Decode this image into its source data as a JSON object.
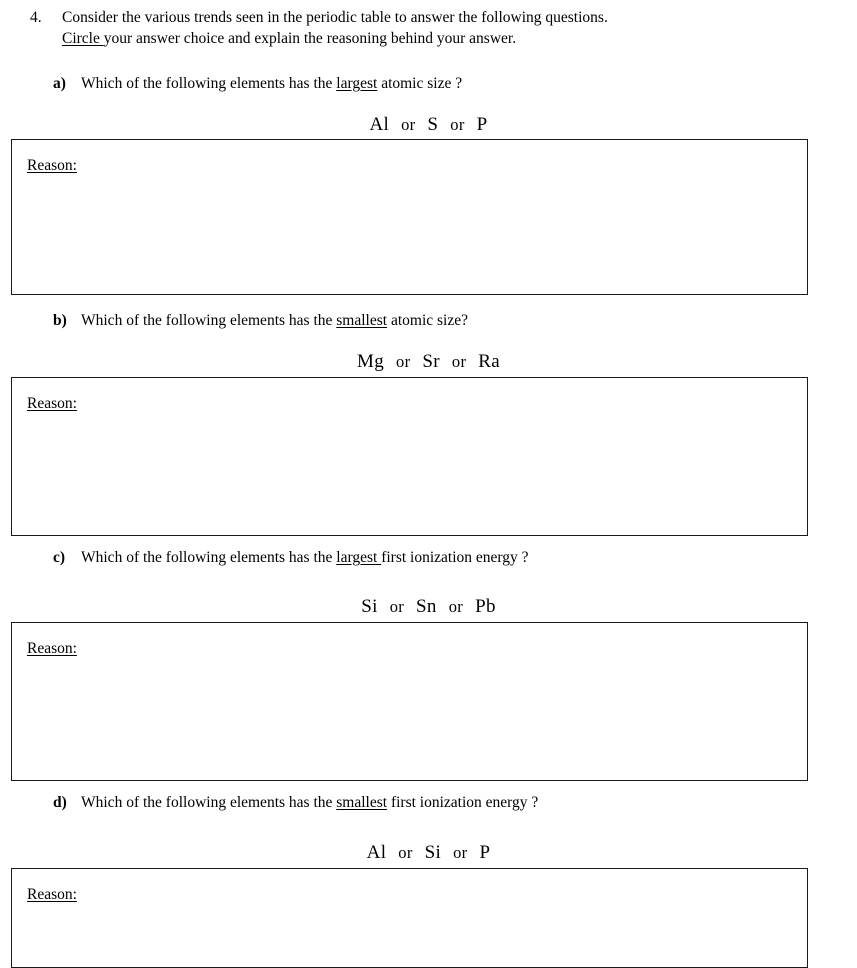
{
  "document": {
    "item_number": "4.",
    "intro_line_1": "Consider the various trends seen in the periodic table to answer the following questions.",
    "intro_line_2_underlined": "Circle ",
    "intro_line_2_rest": "your answer choice and explain the reasoning behind your answer.",
    "conjunction": "or",
    "reason_label": "Reason:"
  },
  "questions": [
    {
      "letter": "a)",
      "text_before": "Which of the following elements has the ",
      "text_underlined": "largest",
      "text_after": " atomic size ?",
      "options": [
        "Al",
        "S",
        "P"
      ]
    },
    {
      "letter": "b)",
      "text_before": "Which of the following elements has the ",
      "text_underlined": "smallest",
      "text_after": " atomic size?",
      "options": [
        "Mg",
        "Sr",
        "Ra"
      ]
    },
    {
      "letter": "c)",
      "text_before": "Which of the following elements has the ",
      "text_underlined": "largest ",
      "text_after": "first ionization energy ?",
      "options": [
        "Si",
        "Sn",
        "Pb"
      ]
    },
    {
      "letter": "d)",
      "text_before": "Which of the following elements has the ",
      "text_underlined": "smallest",
      "text_after": " first ionization energy ?",
      "options": [
        "Al",
        "Si",
        "P"
      ]
    }
  ],
  "colors": {
    "ink": "#000000",
    "border": "#1a1a1a",
    "paper": "#ffffff"
  }
}
